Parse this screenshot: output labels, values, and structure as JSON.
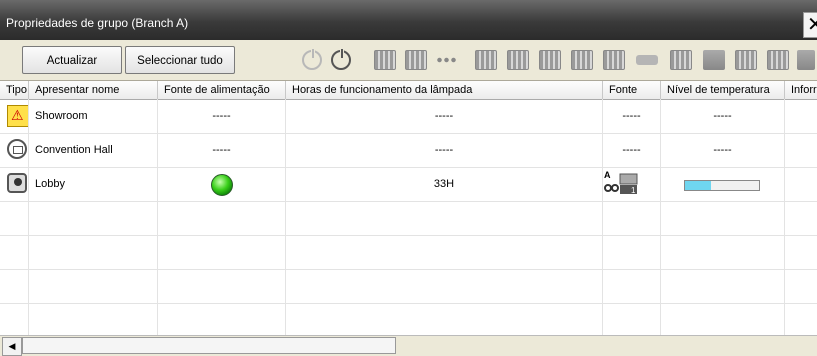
{
  "window": {
    "title": "Propriedades de grupo (Branch A)",
    "close_glyph": "✕"
  },
  "toolbar": {
    "refresh_label": "Actualizar",
    "select_all_label": "Seleccionar tudo"
  },
  "columns": [
    "Tipo",
    "Apresentar nome",
    "Fonte de alimentação",
    "Horas de funcionamento da lâmpada",
    "Fonte",
    "Nível de temperatura",
    "Inforr"
  ],
  "rows": [
    {
      "type_icon": "warning-icon",
      "name": "Showroom",
      "power": "-----",
      "lamp_hours": "-----",
      "source": "-----",
      "temperature": "-----"
    },
    {
      "type_icon": "monitor-icon",
      "name": "Convention Hall",
      "power": "-----",
      "lamp_hours": "-----",
      "source": "-----",
      "temperature": "-----"
    },
    {
      "type_icon": "projector-icon",
      "name": "Lobby",
      "power_icon": "green-led-icon",
      "lamp_hours": "33H",
      "source_icon": "source-a-computer1-icon",
      "temperature_level": 0.35
    }
  ],
  "colors": {
    "led_green": "#3ad01a",
    "temp_fill": "#6fd6f0",
    "title_bar": "#3a3a3a"
  }
}
